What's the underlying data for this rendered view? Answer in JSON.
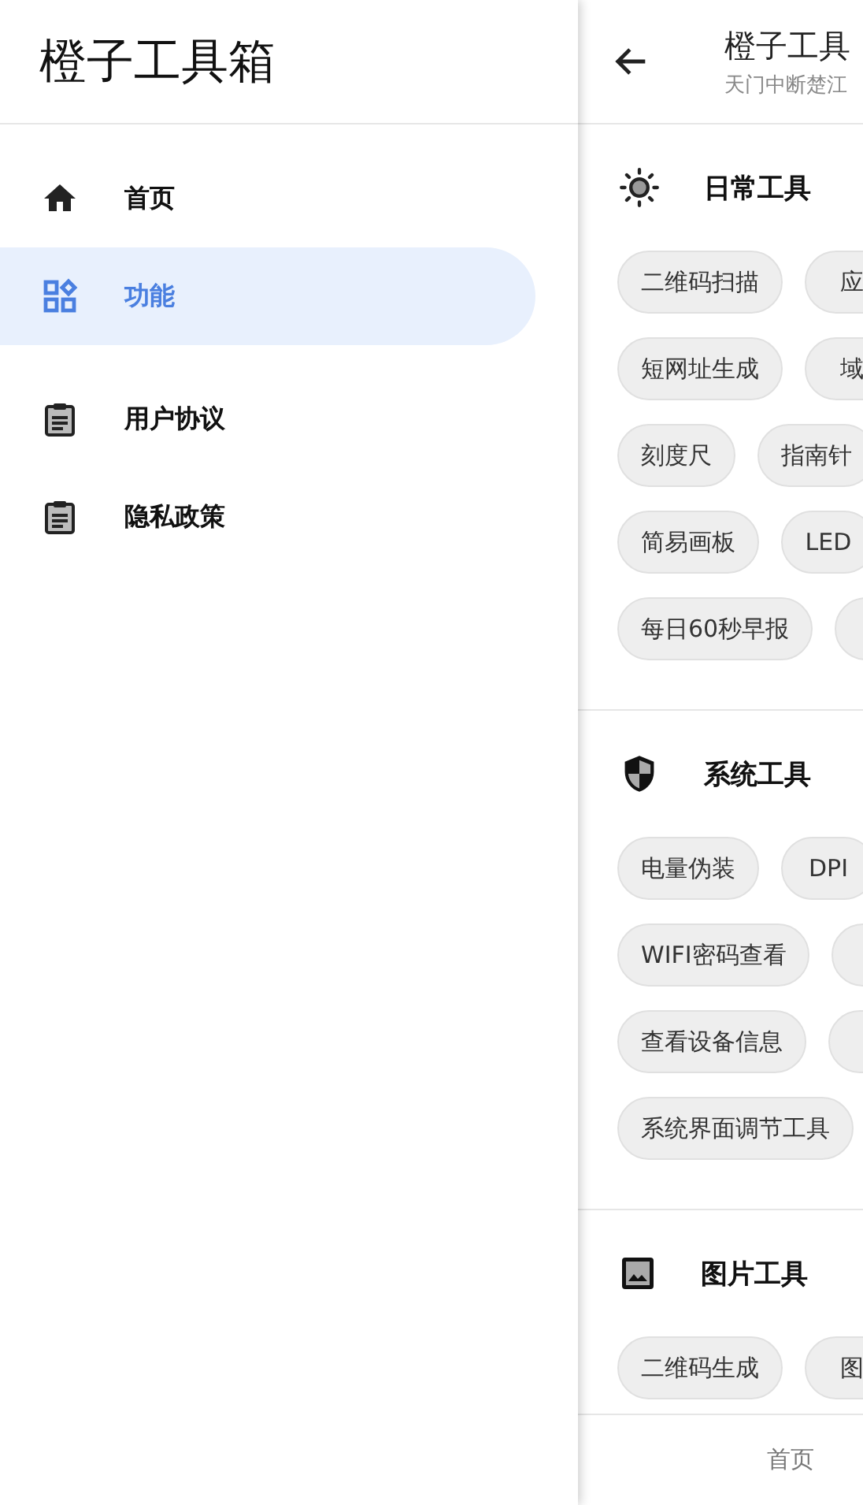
{
  "drawer": {
    "title": "橙子工具箱",
    "items": [
      {
        "label": "首页",
        "selected": false
      },
      {
        "label": "功能",
        "selected": true
      },
      {
        "label": "用户协议",
        "selected": false
      },
      {
        "label": "隐私政策",
        "selected": false
      }
    ]
  },
  "app_bar": {
    "title": "橙子工具",
    "subtitle": "天门中断楚江"
  },
  "sections": [
    {
      "title": "日常工具",
      "rows": [
        {
          "chips": [
            "二维码扫描",
            "应"
          ]
        },
        {
          "chips": [
            "短网址生成",
            "域"
          ]
        },
        {
          "chips": [
            "刻度尺",
            "指南针"
          ]
        },
        {
          "chips": [
            "简易画板",
            "LED"
          ]
        },
        {
          "chips": [
            "每日60秒早报"
          ],
          "trailing_chip": true
        }
      ]
    },
    {
      "title": "系统工具",
      "rows": [
        {
          "chips": [
            "电量伪装",
            "DPI"
          ]
        },
        {
          "chips": [
            "WIFI密码查看"
          ],
          "trailing_chip": true
        },
        {
          "chips": [
            "查看设备信息"
          ],
          "trailing_chip": true
        },
        {
          "chips": [
            "系统界面调节工具"
          ]
        }
      ]
    },
    {
      "title": "图片工具",
      "rows": [
        {
          "chips": [
            "二维码生成",
            "图"
          ]
        }
      ]
    }
  ],
  "bottom_nav": [
    "首页"
  ]
}
